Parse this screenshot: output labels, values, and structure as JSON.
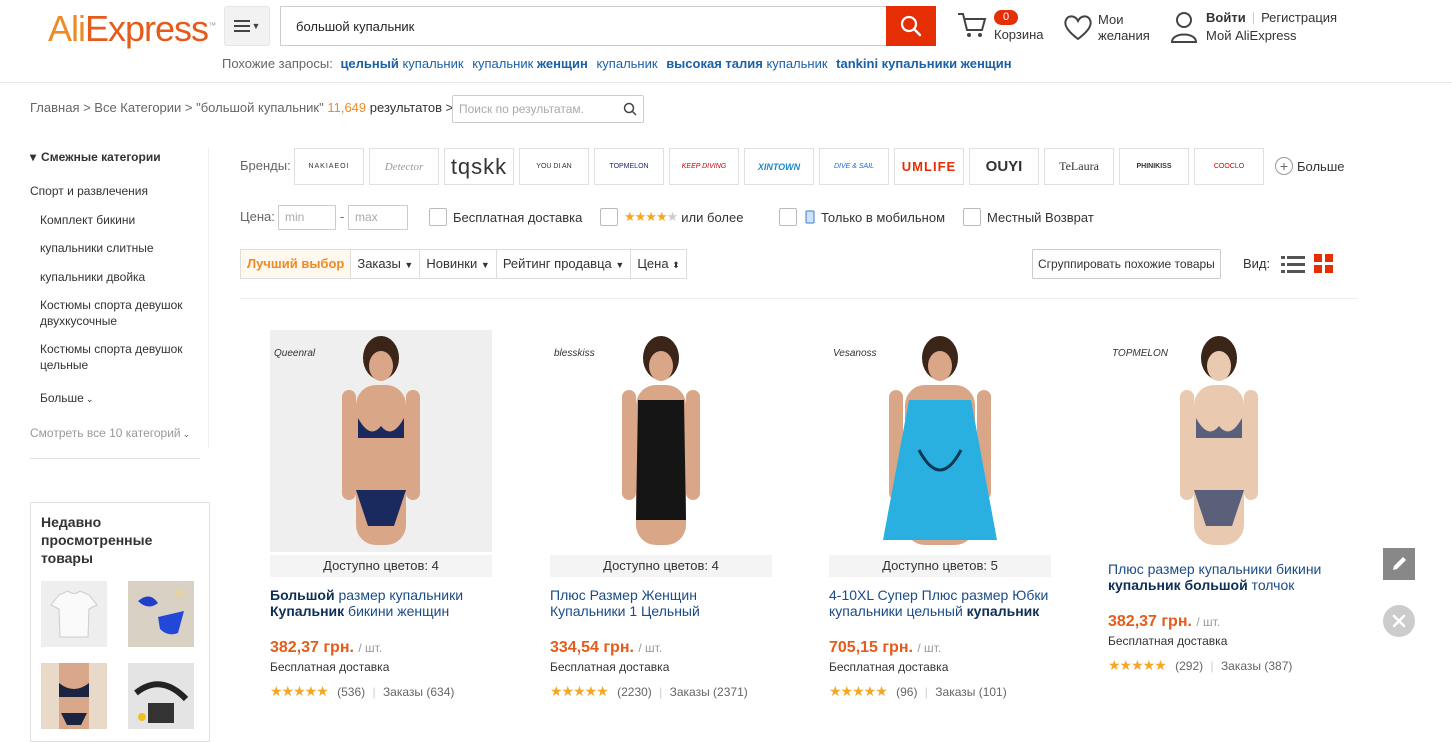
{
  "header": {
    "logo": "AliExpress",
    "search_value": "большой купальник",
    "cart_count": "0",
    "cart_label": "Корзина",
    "wish_label": "Мои желания",
    "login": "Войти",
    "register": "Регистрация",
    "my_account": "Мой AliExpress"
  },
  "related": {
    "label": "Похожие запросы:",
    "items": [
      {
        "bold": "цельный",
        "rest": " купальник"
      },
      {
        "pre": "купальник ",
        "bold": "женщин"
      },
      {
        "rest": "купальник"
      },
      {
        "bold": "высокая талия",
        "rest": " купальник"
      },
      {
        "bold": "tankini купальники женщин"
      }
    ]
  },
  "breadcrumb": {
    "text": "Главная > Все Категории > \"большой купальник\"",
    "count": "11,649",
    "suffix": "результатов >",
    "search_placeholder": "Поиск по результатам."
  },
  "sidebar": {
    "heading": "Смежные категории",
    "items": [
      "Спорт и развлечения",
      "Комплект бикини",
      "купальники слитные",
      "купальники двойка",
      "Костюмы спорта девушок двухкусочные",
      "Костюмы спорта девушок цельные",
      "Больше",
      "Смотреть все 10 категорий"
    ],
    "recent_title": "Недавно просмотренные товары"
  },
  "brands": {
    "label": "Бренды:",
    "items": [
      "NAKIAEOI",
      "Detector",
      "tqskk",
      "YOU DI AN",
      "TOPMELON",
      "KEEP DIVING",
      "XINTOWN",
      "DIVE & SAIL",
      "UMLIFE",
      "OUYI",
      "TeLaura",
      "PHINIKISS",
      "COOCLO"
    ],
    "more": "Больше"
  },
  "filters": {
    "price_label": "Цена:",
    "min_placeholder": "min",
    "max_placeholder": "max",
    "dash": "-",
    "free_shipping": "Бесплатная доставка",
    "rating_more": "или более",
    "mobile_only": "Только в мобильном",
    "local_return": "Местный Возврат"
  },
  "sort": {
    "best": "Лучший выбор",
    "orders": "Заказы",
    "new": "Новинки",
    "seller_rating": "Рейтинг продавца",
    "price": "Цена",
    "group": "Сгруппировать похожие товары",
    "view_label": "Вид:"
  },
  "products": [
    {
      "brand": "Queenral",
      "avail": "Доступно цветов: 4",
      "title_html": [
        "Большой",
        " размер купальники ",
        "Купальник",
        " бикини женщин"
      ],
      "price": "382,37 грн.",
      "unit": "/ шт.",
      "ship": "Бесплатная доставка",
      "reviews": "(536)",
      "orders": "Заказы (634)",
      "swimsuit_color": "#1b2a5e"
    },
    {
      "brand": "blesskiss",
      "avail": "Доступно цветов: 4",
      "title_html": [
        "",
        "Плюс Размер Женщин Купальники 1 Цельный",
        "",
        ""
      ],
      "price": "334,54 грн.",
      "unit": "/ шт.",
      "ship": "Бесплатная доставка",
      "reviews": "(2230)",
      "orders": "Заказы (2371)",
      "swimsuit_color": "#151515"
    },
    {
      "brand": "Vesanoss",
      "avail": "Доступно цветов: 5",
      "title_html": [
        "",
        "4-10XL Супер Плюс размер Юбки купальники цельный ",
        "купальник",
        ""
      ],
      "price": "705,15 грн.",
      "unit": "/ шт.",
      "ship": "Бесплатная доставка",
      "reviews": "(96)",
      "orders": "Заказы (101)",
      "swimsuit_color": "#2ab0e0"
    },
    {
      "brand": "TOPMELON",
      "avail": "",
      "title_html": [
        "",
        "Плюс размер купальники бикини ",
        "купальник большой",
        " толчок"
      ],
      "price": "382,37 грн.",
      "unit": "/ шт.",
      "ship": "Бесплатная доставка",
      "reviews": "(292)",
      "orders": "Заказы (387)",
      "swimsuit_color": "#5a5f7a"
    }
  ],
  "colors": {
    "accent": "#e62e04",
    "orange": "#f08a24",
    "link": "#1a61a8"
  }
}
